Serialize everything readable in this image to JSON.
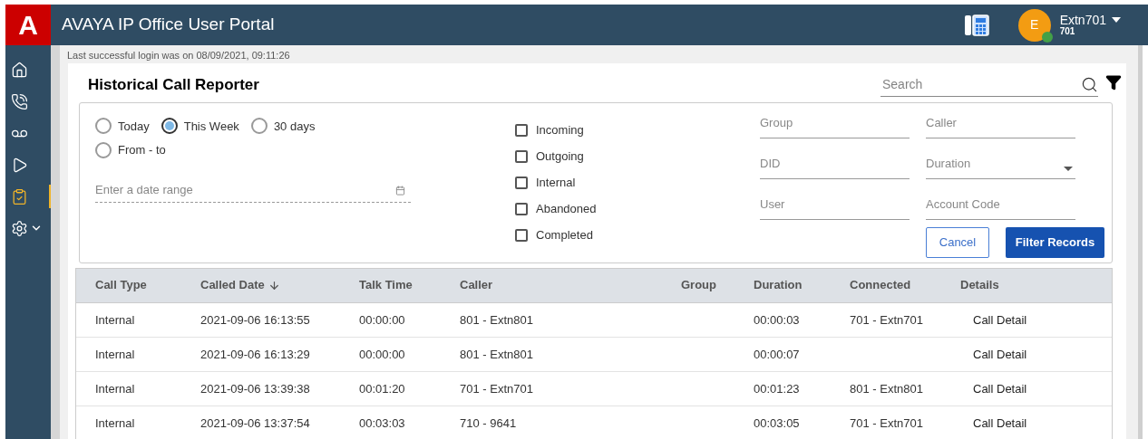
{
  "header": {
    "logo": "A",
    "title": "AVAYA IP Office User Portal",
    "user": {
      "avatar": "E",
      "name": "Extn701",
      "extension": "701",
      "status": {
        "color": "#43a047"
      }
    }
  },
  "sidebar": {
    "items": [
      {
        "kind": "home",
        "selected": false
      },
      {
        "kind": "calls",
        "selected": false
      },
      {
        "kind": "voicemail",
        "selected": false
      },
      {
        "kind": "media",
        "selected": false
      },
      {
        "kind": "reports",
        "selected": true
      },
      {
        "kind": "settings",
        "selected": false
      }
    ]
  },
  "login_notice": "Last successful login was on 08/09/2021, 09:11:26",
  "page_title": "Historical Call Reporter",
  "search": {
    "placeholder": "Search"
  },
  "filters": {
    "periods": [
      {
        "label": "Today",
        "selected": false
      },
      {
        "label": "This Week",
        "selected": true
      },
      {
        "label": "30 days",
        "selected": false
      },
      {
        "label": "From - to",
        "selected": false
      }
    ],
    "date_range": {
      "placeholder": "Enter a date range"
    },
    "call_types": [
      {
        "label": "Incoming",
        "checked": false
      },
      {
        "label": "Outgoing",
        "checked": false
      },
      {
        "label": "Internal",
        "checked": false
      },
      {
        "label": "Abandoned",
        "checked": false
      },
      {
        "label": "Completed",
        "checked": false
      }
    ],
    "fields": [
      {
        "placeholder": "Group",
        "kind": "text"
      },
      {
        "placeholder": "Caller",
        "kind": "text"
      },
      {
        "placeholder": "DID",
        "kind": "text"
      },
      {
        "placeholder": "Duration",
        "kind": "select"
      },
      {
        "placeholder": "User",
        "kind": "text"
      },
      {
        "placeholder": "Account Code",
        "kind": "text"
      }
    ],
    "cancel": "Cancel",
    "submit": "Filter Records"
  },
  "table": {
    "columns": [
      {
        "label": "Call Type",
        "sorted": false
      },
      {
        "label": "Called Date",
        "sorted": true
      },
      {
        "label": "Talk Time",
        "sorted": false
      },
      {
        "label": "Caller",
        "sorted": false
      },
      {
        "label": "Group",
        "sorted": false
      },
      {
        "label": "Duration",
        "sorted": false
      },
      {
        "label": "Connected",
        "sorted": false
      },
      {
        "label": "Details",
        "sorted": false
      }
    ],
    "rows": [
      {
        "cells": [
          "Internal",
          "2021-09-06 16:13:55",
          "00:00:00",
          "801 - Extn801",
          "",
          "00:00:03",
          "701 - Extn701"
        ],
        "details": "Call Detail"
      },
      {
        "cells": [
          "Internal",
          "2021-09-06 16:13:29",
          "00:00:00",
          "801 - Extn801",
          "",
          "00:00:07",
          ""
        ],
        "details": "Call Detail"
      },
      {
        "cells": [
          "Internal",
          "2021-09-06 13:39:38",
          "00:01:20",
          "701 - Extn701",
          "",
          "00:01:23",
          "801 - Extn801"
        ],
        "details": "Call Detail"
      },
      {
        "cells": [
          "Internal",
          "2021-09-06 13:37:54",
          "00:03:03",
          "710 - 9641",
          "",
          "00:03:05",
          "701 - Extn701"
        ],
        "details": "Call Detail"
      }
    ]
  }
}
